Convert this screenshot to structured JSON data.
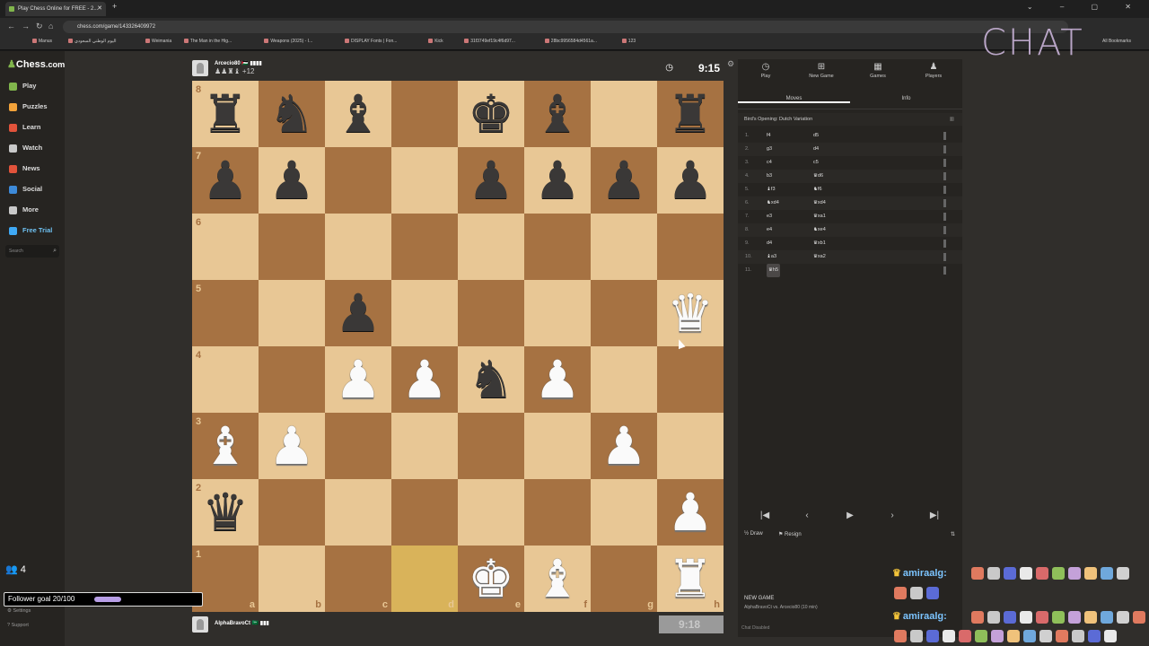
{
  "browser": {
    "tab_title": "Play Chess Online for FREE - 2...",
    "url": "chess.com/game/143326409972",
    "bookmarks": [
      "Manus",
      "اليوم الوطني السعودي",
      "Weimania",
      "The Man in the Hig...",
      "Weapons (2025) - I...",
      "DISPLAY Fonts | Fon...",
      "Kick",
      "31f3749ef19c4f6d97...",
      "28bc9956584d4561a...",
      "123"
    ],
    "all_bookmarks": "All Bookmarks"
  },
  "sidebar": {
    "logo_a": "Chess",
    "logo_b": ".com",
    "items": [
      {
        "label": "Play",
        "color": "#81b64c"
      },
      {
        "label": "Puzzles",
        "color": "#f3a33a"
      },
      {
        "label": "Learn",
        "color": "#e2533b"
      },
      {
        "label": "Watch",
        "color": "#c9c9c9"
      },
      {
        "label": "News",
        "color": "#e2533b"
      },
      {
        "label": "Social",
        "color": "#3d8ad9"
      },
      {
        "label": "More",
        "color": "#c9c9c9"
      },
      {
        "label": "Free Trial",
        "color": "#3fa9f5"
      }
    ],
    "search_placeholder": "Search",
    "settings": "Settings",
    "support": "Support"
  },
  "top_player": {
    "name": "Arcecio80 🇵🇸 ▮▮▮▮",
    "captured": "♟♟♜♝ +12",
    "clock": "9:15"
  },
  "bottom_player": {
    "name": "AlphaBravoCt 🇸🇦 ▮▮▮",
    "clock": "9:18"
  },
  "board": {
    "rows": [
      [
        "bR",
        "bN",
        "bB",
        "",
        "bK",
        "bB",
        "",
        "bR"
      ],
      [
        "bP",
        "bP",
        "",
        "",
        "bP",
        "bP",
        "bP",
        "bP"
      ],
      [
        "",
        "",
        "",
        "",
        "",
        "",
        "",
        ""
      ],
      [
        "",
        "",
        "bP",
        "",
        "",
        "",
        "",
        "wQ"
      ],
      [
        "",
        "",
        "wP",
        "wP",
        "bN",
        "wP",
        "",
        ""
      ],
      [
        "wB",
        "wP",
        "",
        "",
        "",
        "",
        "wP",
        ""
      ],
      [
        "bQ",
        "",
        "",
        "",
        "",
        "",
        "",
        "wP"
      ],
      [
        "",
        "",
        "",
        "hl",
        "wK",
        "wB",
        "",
        "wR"
      ]
    ],
    "ranks": [
      "8",
      "7",
      "6",
      "5",
      "4",
      "3",
      "2",
      "1"
    ],
    "files": [
      "a",
      "b",
      "c",
      "d",
      "e",
      "f",
      "g",
      "h"
    ]
  },
  "panel": {
    "tabs": [
      "Play",
      "New Game",
      "Games",
      "Players"
    ],
    "subtabs": [
      "Moves",
      "Info"
    ],
    "opening": "Bird's Opening: Dutch Variation",
    "moves": [
      {
        "n": "1.",
        "w": "f4",
        "b": "d5"
      },
      {
        "n": "2.",
        "w": "g3",
        "b": "d4"
      },
      {
        "n": "3.",
        "w": "c4",
        "b": "c5"
      },
      {
        "n": "4.",
        "w": "b3",
        "b": "♛d6"
      },
      {
        "n": "5.",
        "w": "♝f3",
        "b": "♞f6"
      },
      {
        "n": "6.",
        "w": "♞xd4",
        "b": "♛xd4"
      },
      {
        "n": "7.",
        "w": "e3",
        "b": "♛xa1"
      },
      {
        "n": "8.",
        "w": "e4",
        "b": "♞xe4"
      },
      {
        "n": "9.",
        "w": "d4",
        "b": "♛xb1"
      },
      {
        "n": "10.",
        "w": "♝a3",
        "b": "♛xa2"
      },
      {
        "n": "11.",
        "w": "♛h5",
        "b": ""
      }
    ],
    "draw": "Draw",
    "resign": "Resign",
    "new_game_title": "NEW GAME",
    "new_game_sub": "AlphaBravoCt vs. Arcecio80 (10 min)",
    "chat_disabled": "Chat Disabled"
  },
  "stream": {
    "chat_label": "CHAT",
    "viewers": "4",
    "follower_goal": "Follower goal 20/100",
    "follower_progress": 0.2,
    "chat_user_1": "amiraalg:",
    "chat_user_2": "amiraalg:"
  }
}
